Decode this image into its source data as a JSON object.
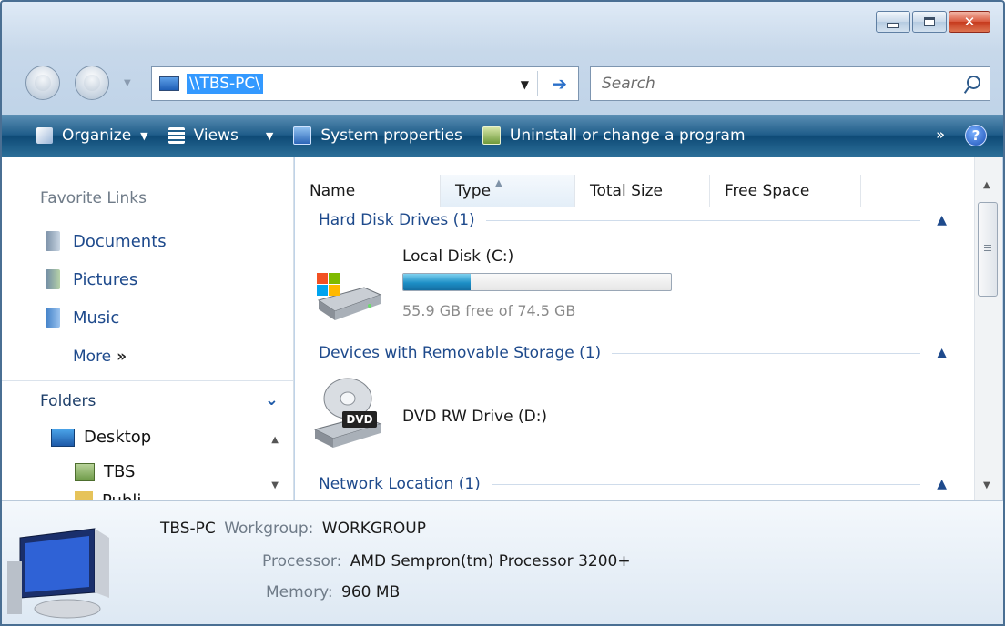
{
  "window": {
    "controls": {
      "minimize": "minimize-icon",
      "maximize": "maximize-icon",
      "close": "close-icon"
    }
  },
  "navigation": {
    "back_icon": "back-arrow-icon",
    "forward_icon": "forward-arrow-icon",
    "address_value": "\\\\TBS-PC\\",
    "search_placeholder": "Search"
  },
  "toolbar": {
    "organize": "Organize",
    "views": "Views",
    "system_properties": "System properties",
    "uninstall": "Uninstall or change a program",
    "overflow": "»",
    "help": "?"
  },
  "sidebar": {
    "favorite_links_heading": "Favorite Links",
    "favorites": [
      {
        "label": "Documents",
        "icon": "documents-icon"
      },
      {
        "label": "Pictures",
        "icon": "pictures-icon"
      },
      {
        "label": "Music",
        "icon": "music-icon"
      }
    ],
    "more_label": "More",
    "more_glyph": "»",
    "folders_heading": "Folders",
    "tree": [
      {
        "label": "Desktop",
        "icon": "desktop-icon"
      },
      {
        "label": "TBS",
        "icon": "user-folder-icon"
      },
      {
        "label": "Publi",
        "icon": "folder-icon"
      }
    ]
  },
  "list": {
    "columns": [
      "Name",
      "Type",
      "Total Size",
      "Free Space"
    ],
    "sorted_column": "Type",
    "groups": [
      {
        "title": "Hard Disk Drives (1)",
        "items": [
          {
            "name": "Local Disk (C:)",
            "detail": "55.9 GB free of 74.5 GB",
            "used_fraction": 0.25,
            "icon": "hard-disk-icon"
          }
        ]
      },
      {
        "title": "Devices with Removable Storage (1)",
        "items": [
          {
            "name": "DVD RW Drive (D:)",
            "badge": "DVD",
            "icon": "dvd-drive-icon"
          }
        ]
      },
      {
        "title": "Network Location (1)",
        "items": []
      }
    ]
  },
  "details": {
    "computer_name": "TBS-PC",
    "workgroup_label": "Workgroup:",
    "workgroup_value": "WORKGROUP",
    "processor_label": "Processor:",
    "processor_value": "AMD Sempron(tm) Processor 3200+",
    "memory_label": "Memory:",
    "memory_value": "960 MB"
  },
  "colors": {
    "toolbar": "#1f5d8a",
    "link": "#1e4a8c",
    "usage_bar": "#1d8fc6",
    "selection": "#3399ff"
  }
}
